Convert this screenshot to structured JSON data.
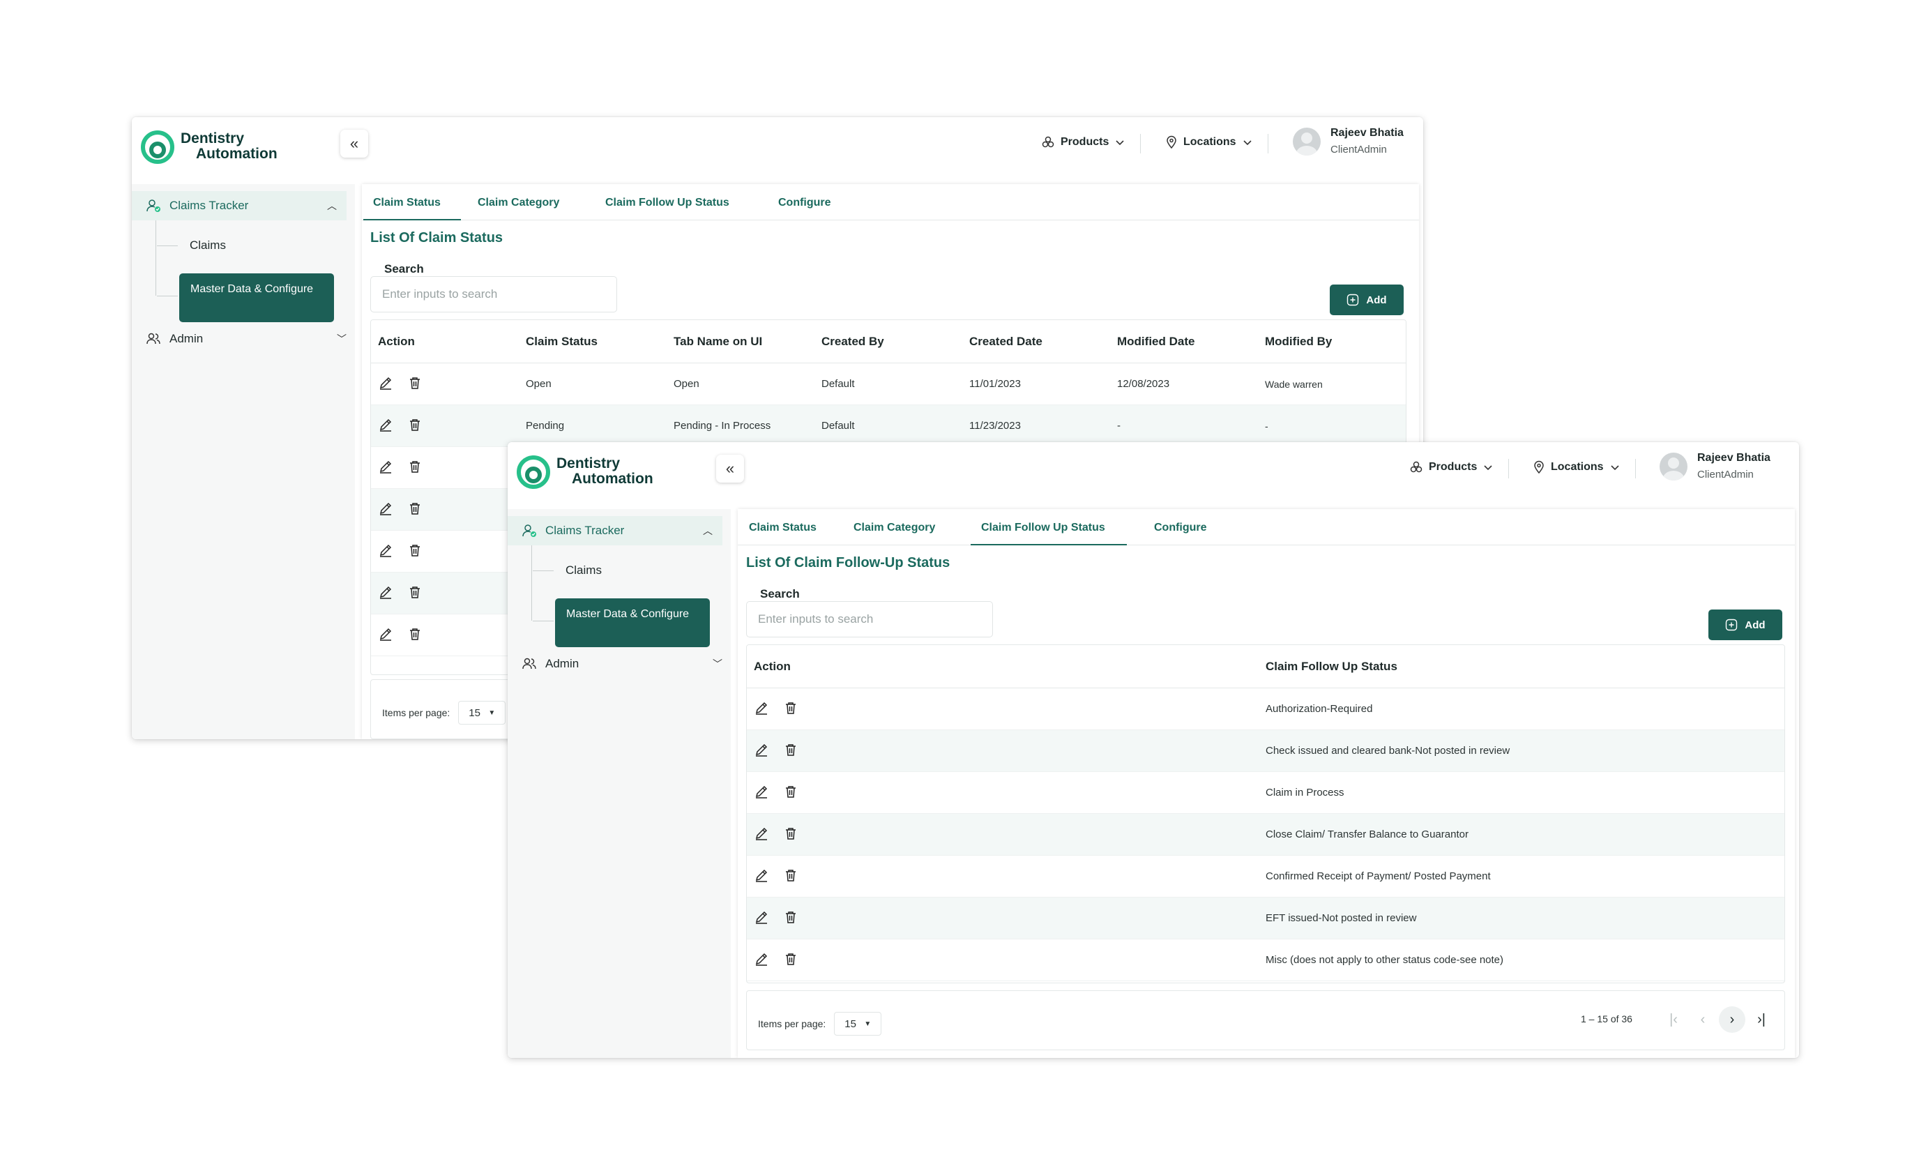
{
  "colors": {
    "primary": "#1c5f56",
    "accent": "#1b6a5e",
    "sidebar_active_bg": "#e8f2ef",
    "row_alt": "#f3f8f7"
  },
  "app": {
    "logo_line1": "Dentistry",
    "logo_line2": "Automation"
  },
  "header": {
    "products_label": "Products",
    "locations_label": "Locations",
    "user_name": "Rajeev Bhatia",
    "user_role": "ClientAdmin"
  },
  "sidebar": {
    "claims_tracker": "Claims Tracker",
    "claims": "Claims",
    "master_data": "Master Data & Configure",
    "admin": "Admin"
  },
  "tabs": [
    "Claim Status",
    "Claim Category",
    "Claim Follow Up Status",
    "Configure"
  ],
  "search": {
    "label": "Search",
    "placeholder": "Enter inputs to search"
  },
  "add_label": "Add",
  "window1": {
    "title": "List Of Claim Status",
    "columns": [
      "Action",
      "Claim Status",
      "Tab Name on UI",
      "Created By",
      "Created Date",
      "Modified Date",
      "Modified By"
    ],
    "rows": [
      [
        "Open",
        "Open",
        "Default",
        "11/01/2023",
        "12/08/2023",
        "Wade warren"
      ],
      [
        "Pending",
        "Pending - In Process",
        "Default",
        "11/23/2023",
        "-",
        "-"
      ]
    ],
    "empty_rows": 5,
    "items_per_page_label": "Items per page:",
    "items_per_page": "15"
  },
  "window2": {
    "title": "List Of Claim Follow-Up Status",
    "columns": [
      "Action",
      "Claim Follow Up Status"
    ],
    "rows": [
      "Authorization-Required",
      "Check issued and cleared bank-Not posted in review",
      "Claim in Process",
      "Close Claim/ Transfer Balance to Guarantor",
      "Confirmed Receipt of Payment/ Posted Payment",
      "EFT issued-Not posted in review",
      "Misc (does not apply to other status code-see note)"
    ],
    "items_per_page_label": "Items per page:",
    "items_per_page": "15",
    "range": "1 – 15 of 36"
  }
}
